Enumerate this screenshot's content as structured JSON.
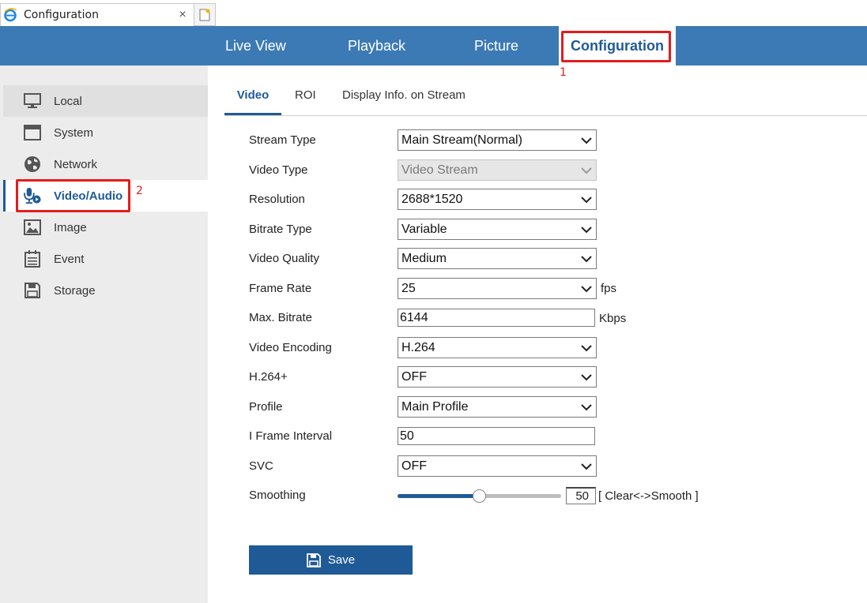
{
  "browser": {
    "tab_title": "Configuration",
    "close_glyph": "×"
  },
  "topnav": {
    "items": [
      {
        "label": "Live View"
      },
      {
        "label": "Playback"
      },
      {
        "label": "Picture"
      },
      {
        "label": "Configuration",
        "active": true
      }
    ]
  },
  "annotations": {
    "callout_1": "1",
    "callout_2": "2"
  },
  "sidebar": {
    "items": [
      {
        "label": "Local",
        "icon": "monitor-icon"
      },
      {
        "label": "System",
        "icon": "window-icon"
      },
      {
        "label": "Network",
        "icon": "globe-icon"
      },
      {
        "label": "Video/Audio",
        "icon": "video-audio-icon",
        "active": true
      },
      {
        "label": "Image",
        "icon": "image-icon"
      },
      {
        "label": "Event",
        "icon": "calendar-icon"
      },
      {
        "label": "Storage",
        "icon": "floppy-icon"
      }
    ]
  },
  "subtabs": {
    "items": [
      {
        "label": "Video",
        "active": true
      },
      {
        "label": "ROI"
      },
      {
        "label": "Display Info. on Stream"
      }
    ]
  },
  "form": {
    "stream_type": {
      "label": "Stream Type",
      "value": "Main Stream(Normal)"
    },
    "video_type": {
      "label": "Video Type",
      "value": "Video Stream",
      "disabled": true
    },
    "resolution": {
      "label": "Resolution",
      "value": "2688*1520"
    },
    "bitrate_type": {
      "label": "Bitrate Type",
      "value": "Variable"
    },
    "video_quality": {
      "label": "Video Quality",
      "value": "Medium"
    },
    "frame_rate": {
      "label": "Frame Rate",
      "value": "25",
      "unit": "fps"
    },
    "max_bitrate": {
      "label": "Max. Bitrate",
      "value": "6144",
      "unit": "Kbps"
    },
    "video_encoding": {
      "label": "Video Encoding",
      "value": "H.264"
    },
    "h264_plus": {
      "label": "H.264+",
      "value": "OFF"
    },
    "profile": {
      "label": "Profile",
      "value": "Main Profile"
    },
    "i_frame_interval": {
      "label": "I Frame Interval",
      "value": "50"
    },
    "svc": {
      "label": "SVC",
      "value": "OFF"
    },
    "smoothing": {
      "label": "Smoothing",
      "value": "50",
      "fraction": 0.5,
      "hint": "[ Clear<->Smooth ]"
    }
  },
  "save": {
    "label": "Save"
  },
  "colors": {
    "nav_blue": "#3c7ab5",
    "accent_blue": "#1f5a96",
    "highlight_red": "#e41c1c"
  }
}
